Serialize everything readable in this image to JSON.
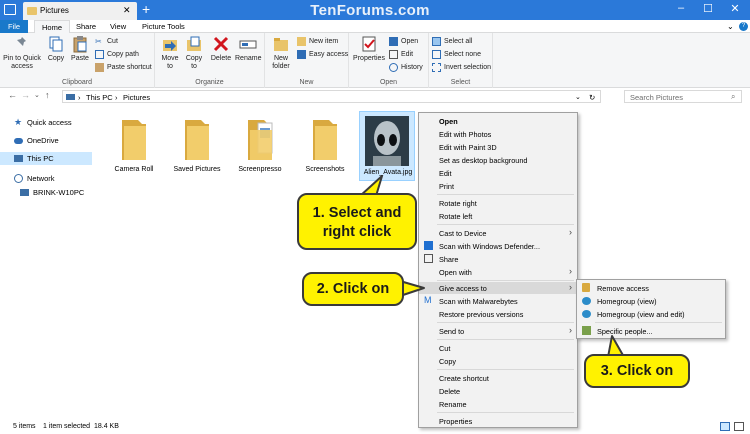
{
  "window": {
    "title": "Pictures",
    "watermark": "TenForums.com",
    "controls": {
      "minimize": "–",
      "maximize": "☐",
      "close": "✕"
    },
    "accent": "#2b79d9"
  },
  "ribbon_tabs": {
    "file": "File",
    "home": "Home",
    "share": "Share",
    "view": "View",
    "tools": "Picture Tools"
  },
  "ribbon": {
    "clipboard": {
      "pin": "Pin to Quick access",
      "copy": "Copy",
      "paste": "Paste",
      "cut": "Cut",
      "copy_path": "Copy path",
      "paste_shortcut": "Paste shortcut",
      "label": "Clipboard"
    },
    "organize": {
      "move": "Move to",
      "copy": "Copy to",
      "delete": "Delete",
      "rename": "Rename",
      "label": "Organize"
    },
    "new": {
      "folder": "New folder",
      "new_item": "New item",
      "easy_access": "Easy access",
      "label": "New"
    },
    "open": {
      "properties": "Properties",
      "open": "Open",
      "edit": "Edit",
      "history": "History",
      "label": "Open"
    },
    "select": {
      "all": "Select all",
      "none": "Select none",
      "invert": "Invert selection",
      "label": "Select"
    }
  },
  "address": {
    "this_pc": "This PC",
    "pictures": "Pictures",
    "search_placeholder": "Search Pictures"
  },
  "nav": [
    "Quick access",
    "OneDrive",
    "This PC",
    "Network",
    "BRINK-W10PC"
  ],
  "folders": [
    "Camera Roll",
    "Saved Pictures",
    "Screenpresso",
    "Screenshots"
  ],
  "selected_file": "Alien_Avata.jpg",
  "status": {
    "items": "5 items",
    "selection": "1 item selected  18.4 KB"
  },
  "context_menu": [
    "Open",
    "Edit with Photos",
    "Edit with Paint 3D",
    "Set as desktop background",
    "Edit",
    "Print",
    "Rotate right",
    "Rotate left",
    "Cast to Device",
    "Scan with Windows Defender...",
    "Share",
    "Open with",
    "Give access to",
    "Scan with Malwarebytes",
    "Restore previous versions",
    "Send to",
    "Cut",
    "Copy",
    "Create shortcut",
    "Delete",
    "Rename",
    "Properties"
  ],
  "submenu": [
    "Remove access",
    "Homegroup (view)",
    "Homegroup (view and edit)",
    "Specific people..."
  ],
  "callouts": {
    "step1_line1": "1. Select and",
    "step1_line2": "right  click",
    "step2": "2. Click on",
    "step3": "3. Click on"
  }
}
